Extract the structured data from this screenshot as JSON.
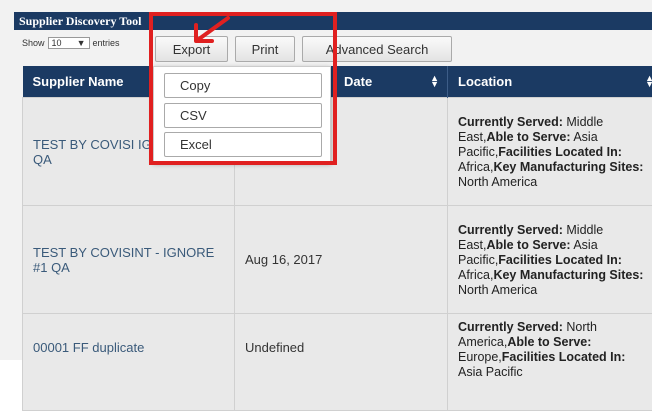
{
  "window": {
    "title": "Supplier Discovery Tool"
  },
  "length_control": {
    "show_label": "Show",
    "value": "10",
    "entries_label": "entries"
  },
  "toolbar": {
    "export_label": "Export",
    "print_label": "Print",
    "advanced_search_label": "Advanced Search"
  },
  "export_menu": {
    "items": [
      "Copy",
      "CSV",
      "Excel"
    ]
  },
  "table": {
    "columns": [
      "Supplier Name",
      "Date",
      "Location"
    ],
    "rows": [
      {
        "name": "TEST BY COVISINT - IGNORE #1 QA",
        "name_visible": "TEST BY COVISI IGNORE #1 QA",
        "date": "",
        "location": {
          "currently_served_label": "Currently Served:",
          "currently_served": " Middle East,",
          "able_to_serve_label": "Able to Serve:",
          "able_to_serve": " Asia Pacific,",
          "facilities_label": "Facilities Located In:",
          "facilities": " Africa,",
          "key_sites_label": "Key Manufacturing Sites:",
          "key_sites": " North America"
        }
      },
      {
        "name": "TEST BY COVISINT - IGNORE #1 QA",
        "date": "Aug 16, 2017",
        "location": {
          "currently_served_label": "Currently Served:",
          "currently_served": " Middle East,",
          "able_to_serve_label": "Able to Serve:",
          "able_to_serve": " Asia Pacific,",
          "facilities_label": "Facilities Located In:",
          "facilities": " Africa,",
          "key_sites_label": "Key Manufacturing Sites:",
          "key_sites": " North America"
        }
      },
      {
        "name": "00001 FF duplicate",
        "date": "Undefined",
        "location": {
          "currently_served_label": "Currently Served:",
          "currently_served": " North America,",
          "able_to_serve_label": "Able to Serve:",
          "able_to_serve": " Europe,",
          "facilities_label": "Facilities Located In:",
          "facilities": " Asia Pacific"
        }
      }
    ]
  },
  "annotation": {
    "highlight_color": "#e02020",
    "arrow_icon": "arrow-down-left-icon"
  },
  "colors": {
    "header_bg": "#1b3a63",
    "row_bg": "#e9e9e9",
    "name_text": "#3a5a7a"
  }
}
